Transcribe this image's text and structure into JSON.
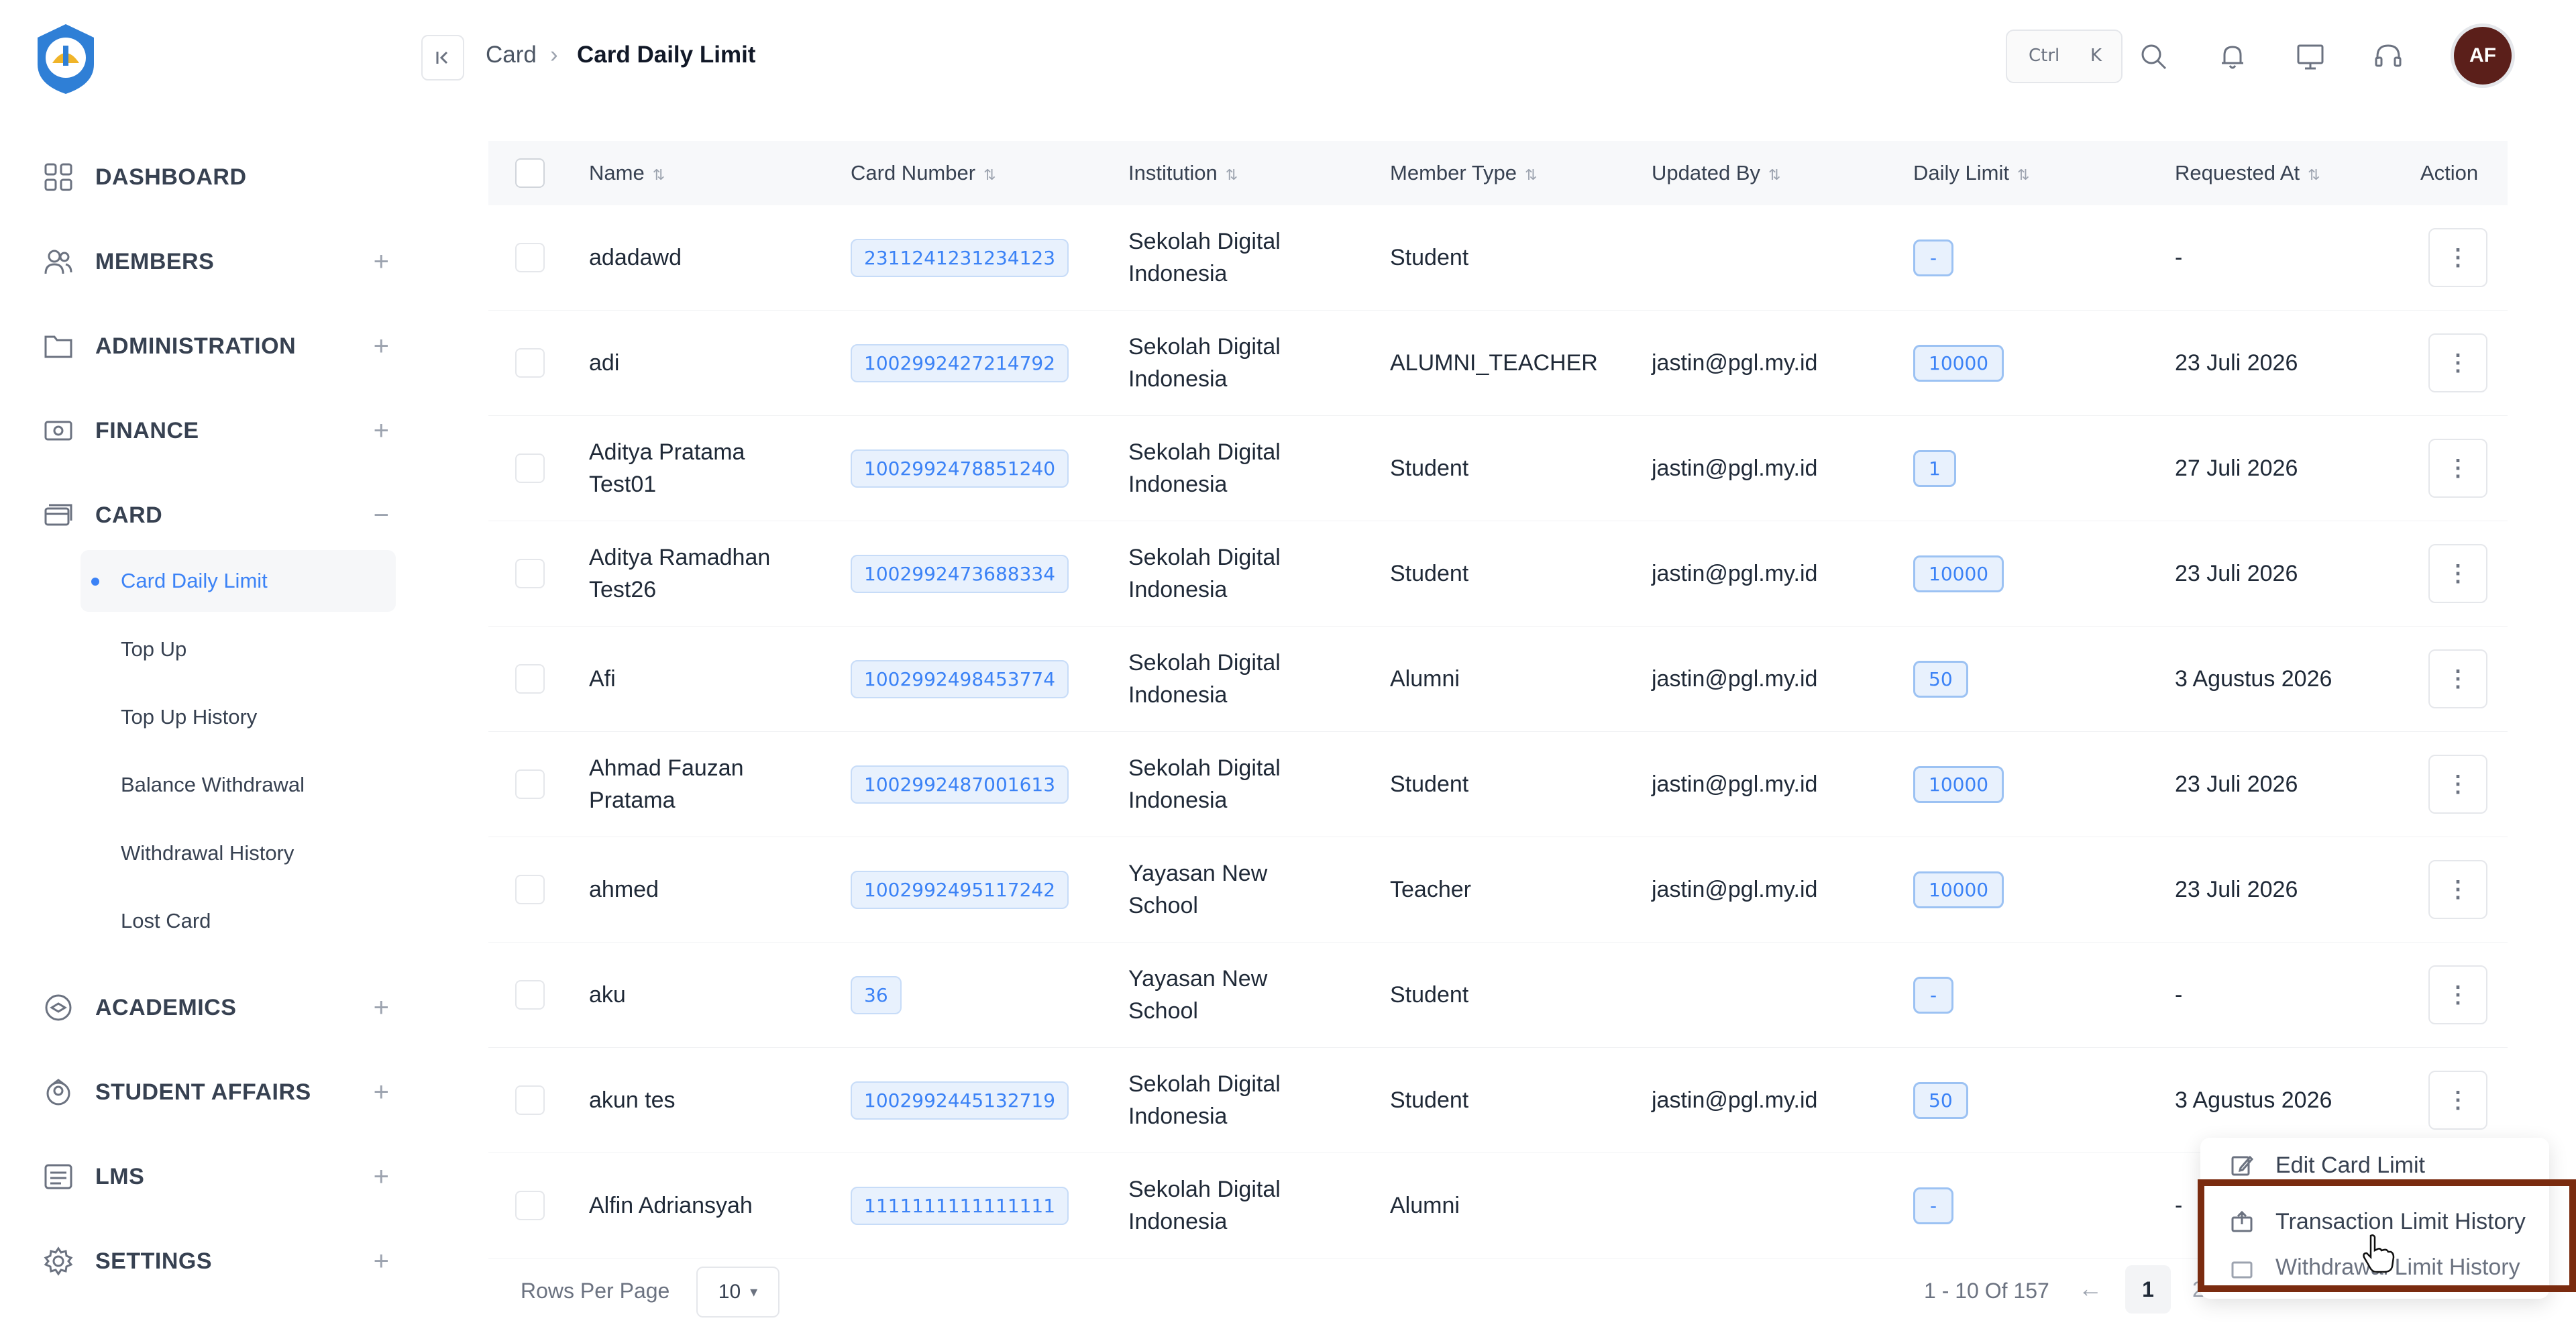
{
  "sidebar": {
    "items": [
      {
        "label": "DASHBOARD",
        "icon": "grid-icon",
        "toggle": ""
      },
      {
        "label": "MEMBERS",
        "icon": "users-icon",
        "toggle": "+"
      },
      {
        "label": "ADMINISTRATION",
        "icon": "folder-icon",
        "toggle": "+"
      },
      {
        "label": "FINANCE",
        "icon": "money-icon",
        "toggle": "+"
      },
      {
        "label": "CARD",
        "icon": "card-icon",
        "toggle": "−"
      },
      {
        "label": "ACADEMICS",
        "icon": "academics-icon",
        "toggle": "+"
      },
      {
        "label": "STUDENT AFFAIRS",
        "icon": "student-icon",
        "toggle": "+"
      },
      {
        "label": "LMS",
        "icon": "lms-icon",
        "toggle": "+"
      },
      {
        "label": "SETTINGS",
        "icon": "settings-icon",
        "toggle": "+"
      }
    ],
    "card_sub": [
      "Card Daily Limit",
      "Top Up",
      "Top Up History",
      "Balance Withdrawal",
      "Withdrawal History",
      "Lost Card"
    ]
  },
  "header": {
    "breadcrumb_parent": "Card",
    "breadcrumb_sep": "›",
    "breadcrumb_current": "Card Daily Limit",
    "kbd_ctrl": "Ctrl",
    "kbd_k": "K",
    "avatar": "AF"
  },
  "table": {
    "columns": [
      "Name",
      "Card Number",
      "Institution",
      "Member Type",
      "Updated By",
      "Daily Limit",
      "Requested At",
      "Action"
    ],
    "rows": [
      {
        "name": [
          "adadawd",
          ""
        ],
        "card": "2311241231234123",
        "inst": [
          "Sekolah Digital",
          "Indonesia"
        ],
        "type": "Student",
        "updated": "",
        "limit": "-",
        "requested": "-"
      },
      {
        "name": [
          "adi",
          ""
        ],
        "card": "1002992427214792",
        "inst": [
          "Sekolah Digital",
          "Indonesia"
        ],
        "type": "ALUMNI_TEACHER",
        "updated": "jastin@pgl.my.id",
        "limit": "10000",
        "requested": "23 Juli 2026"
      },
      {
        "name": [
          "Aditya Pratama",
          "Test01"
        ],
        "card": "1002992478851240",
        "inst": [
          "Sekolah Digital",
          "Indonesia"
        ],
        "type": "Student",
        "updated": "jastin@pgl.my.id",
        "limit": "1",
        "requested": "27 Juli 2026"
      },
      {
        "name": [
          "Aditya Ramadhan",
          "Test26"
        ],
        "card": "1002992473688334",
        "inst": [
          "Sekolah Digital",
          "Indonesia"
        ],
        "type": "Student",
        "updated": "jastin@pgl.my.id",
        "limit": "10000",
        "requested": "23 Juli 2026"
      },
      {
        "name": [
          "Afi",
          ""
        ],
        "card": "1002992498453774",
        "inst": [
          "Sekolah Digital",
          "Indonesia"
        ],
        "type": "Alumni",
        "updated": "jastin@pgl.my.id",
        "limit": "50",
        "requested": "3 Agustus 2026"
      },
      {
        "name": [
          "Ahmad Fauzan",
          "Pratama"
        ],
        "card": "1002992487001613",
        "inst": [
          "Sekolah Digital",
          "Indonesia"
        ],
        "type": "Student",
        "updated": "jastin@pgl.my.id",
        "limit": "10000",
        "requested": "23 Juli 2026"
      },
      {
        "name": [
          "ahmed",
          ""
        ],
        "card": "1002992495117242",
        "inst": [
          "Yayasan New",
          "School"
        ],
        "type": "Teacher",
        "updated": "jastin@pgl.my.id",
        "limit": "10000",
        "requested": "23 Juli 2026"
      },
      {
        "name": [
          "aku",
          ""
        ],
        "card": "36",
        "inst": [
          "Yayasan New",
          "School"
        ],
        "type": "Student",
        "updated": "",
        "limit": "-",
        "requested": "-"
      },
      {
        "name": [
          "akun tes",
          ""
        ],
        "card": "1002992445132719",
        "inst": [
          "Sekolah Digital",
          "Indonesia"
        ],
        "type": "Student",
        "updated": "jastin@pgl.my.id",
        "limit": "50",
        "requested": "3 Agustus 2026"
      },
      {
        "name": [
          "Alfin Adriansyah",
          ""
        ],
        "card": "1111111111111111",
        "inst": [
          "Sekolah Digital",
          "Indonesia"
        ],
        "type": "Alumni",
        "updated": "",
        "limit": "-",
        "requested": "-"
      }
    ]
  },
  "footer": {
    "rows_label": "Rows Per Page",
    "rows_value": "10",
    "range": "1 - 10 Of 157",
    "prev": "←",
    "current_page": "1",
    "next_page": "2"
  },
  "dropdown": {
    "items": [
      {
        "label": "Edit Card Limit",
        "icon": "edit-icon"
      },
      {
        "label": "Transaction Limit History",
        "icon": "history-icon"
      },
      {
        "label": "Withdrawal Limit History",
        "icon": "withdrawal-icon"
      }
    ]
  },
  "colors": {
    "accent": "#3b82f6",
    "highlight_border": "#7a2b0f",
    "avatar_bg": "#5b1f1a"
  }
}
